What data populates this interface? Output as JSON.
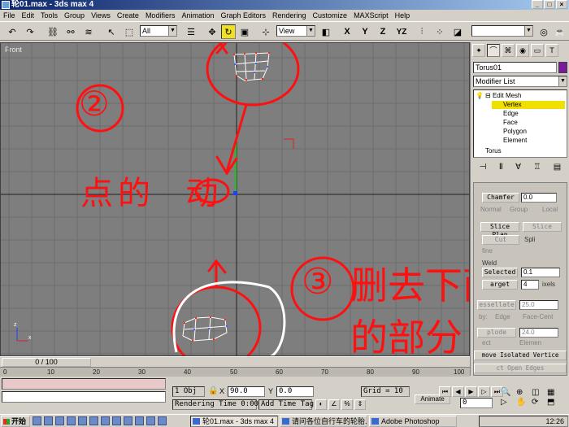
{
  "window": {
    "title": "轮01.max - 3ds max 4",
    "buttons": [
      "_",
      "□",
      "×"
    ]
  },
  "menu": [
    "File",
    "Edit",
    "Tools",
    "Group",
    "Views",
    "Create",
    "Modifiers",
    "Animation",
    "Graph Editors",
    "Rendering",
    "Customize",
    "MAXScript",
    "Help"
  ],
  "toolbar": {
    "selection_filter": "All",
    "view_combo": "View",
    "axis_x": "X",
    "axis_y": "Y",
    "axis_z": "Z",
    "axis_yz": "YZ"
  },
  "viewport": {
    "label": "Front"
  },
  "annotations": {
    "step1": "1",
    "step2": "②",
    "step2_text": "点的  动",
    "step3": "③",
    "step3_text_line1": "删去下面",
    "step3_text_line2": "的部分"
  },
  "right_panel": {
    "tabs": [
      "create-icon",
      "modify-icon",
      "hierarchy-icon",
      "motion-icon",
      "display-icon",
      "utilities-icon"
    ],
    "object_name": "Torus01",
    "object_color": "#7a1a98",
    "modifier_list": "Modifier List",
    "stack": {
      "edit_mesh": "Edit Mesh",
      "vertex": "Vertex",
      "edge": "Edge",
      "face": "Face",
      "polygon": "Polygon",
      "element": "Element",
      "torus": "Torus"
    },
    "rollout": {
      "chamfer": "Chamfer",
      "chamfer_val": "0.0",
      "normal": "Normal",
      "group": "Group",
      "local": "Local",
      "slice_plane": "Slice Plan",
      "slice": "Slice",
      "cut": "Cut",
      "split": "Spli",
      "refine": "fine",
      "weld": "Weld",
      "selected": "Selected",
      "selected_val": "0.1",
      "target": "arget",
      "target_val": "4",
      "pixels": "ixels",
      "tessellate": "essellate",
      "tess_val": "25.0",
      "by": "by:",
      "edge": "Edge",
      "face_center": "Face-Cent",
      "explode": "plode",
      "explode_val": "24.0",
      "object": "ect",
      "elements": "Elemen",
      "remove_isolated": "move Isolated Vertice",
      "select_open_edges": "ct Open Edges"
    }
  },
  "timeline": {
    "slider": "0 / 100",
    "ticks": [
      "0",
      "10",
      "20",
      "30",
      "40",
      "50",
      "60",
      "70",
      "80",
      "90",
      "100"
    ]
  },
  "status": {
    "objects": "1 Obj",
    "x_label": "X",
    "x_val": "90.0",
    "y_label": "Y",
    "y_val": "0.0",
    "grid": "Grid = 10",
    "animate": "Animate",
    "rendering_time": "Rendering Time  0:00:",
    "add_time_tag": "Add Time Tag",
    "frame": "0"
  },
  "taskbar": {
    "start": "开始",
    "tasks": [
      "轮01.max - 3ds max 4",
      "请问各位自行车的轮胎...",
      "Adobe Photoshop"
    ],
    "clock": "12:26"
  }
}
